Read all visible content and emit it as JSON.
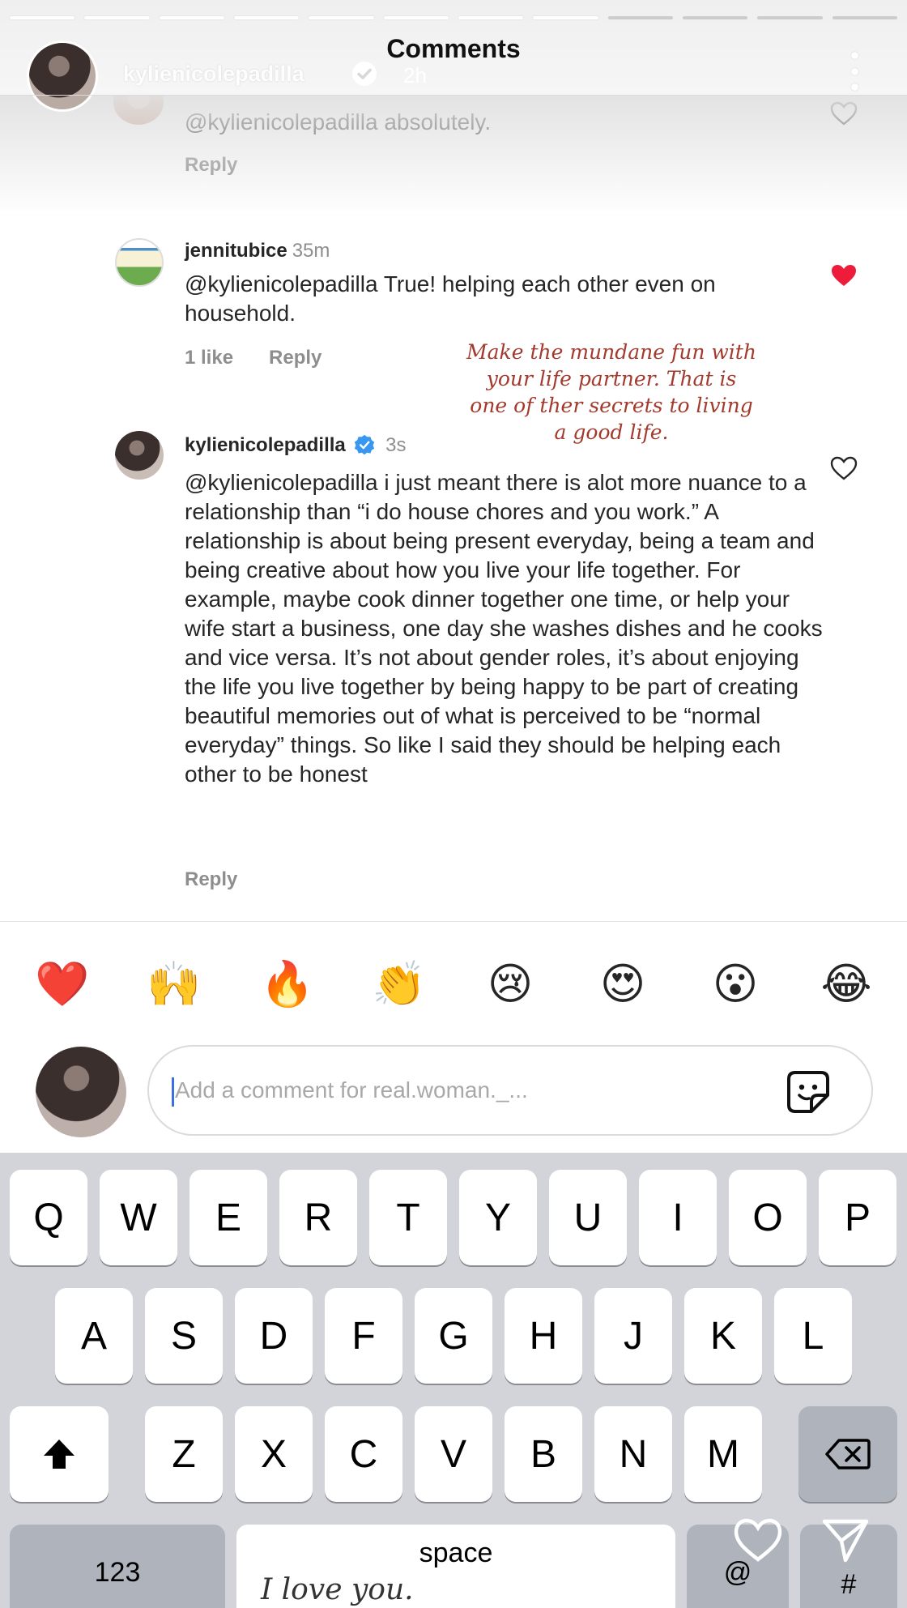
{
  "story": {
    "title": "Comments",
    "username": "kylienicolepadilla",
    "time": "2h",
    "progress_total": 12,
    "progress_done": 8
  },
  "comments": [
    {
      "text": "@kylienicolepadilla absolutely.",
      "reply": "Reply"
    },
    {
      "username": "jennitubice",
      "time": "35m",
      "text": "@kylienicolepadilla True! helping each other even on household.",
      "likes": "1 like",
      "reply": "Reply",
      "liked": true
    },
    {
      "username": "kylienicolepadilla",
      "time": "3s",
      "text": "@kylienicolepadilla i just meant there is alot more nuance to a relationship than “i do house chores and you work.” A relationship is about being present everyday, being a team and being creative about how you live your life together. For example, maybe cook dinner together one time, or help your wife start a business, one day she washes dishes and he cooks and vice versa. It’s not about gender roles, it’s about enjoying the life you live together by being happy to be part of creating beautiful memories out of what is perceived to be “normal everyday” things. So like I said they should be helping each other to be honest",
      "reply": "Reply"
    }
  ],
  "overlay_quote": "Make the mundane fun with your life partner. That is one of ther secrets to living a good life.",
  "emojis": [
    "❤️",
    "🙌",
    "🔥",
    "👏",
    "😢",
    "😍",
    "😮",
    "😂"
  ],
  "input": {
    "placeholder": "Add a comment for real.woman._..."
  },
  "keyboard": {
    "row1": [
      "Q",
      "W",
      "E",
      "R",
      "T",
      "Y",
      "U",
      "I",
      "O",
      "P"
    ],
    "row2": [
      "A",
      "S",
      "D",
      "F",
      "G",
      "H",
      "J",
      "K",
      "L"
    ],
    "row3": [
      "Z",
      "X",
      "C",
      "V",
      "B",
      "N",
      "M"
    ],
    "numbers": "123",
    "space": "space",
    "at": "@",
    "hash": "#"
  },
  "story_text": "I love you.",
  "colors": {
    "liked_heart": "#ed1c3a",
    "verified": "#3897f0",
    "quote": "#a33a2e"
  }
}
